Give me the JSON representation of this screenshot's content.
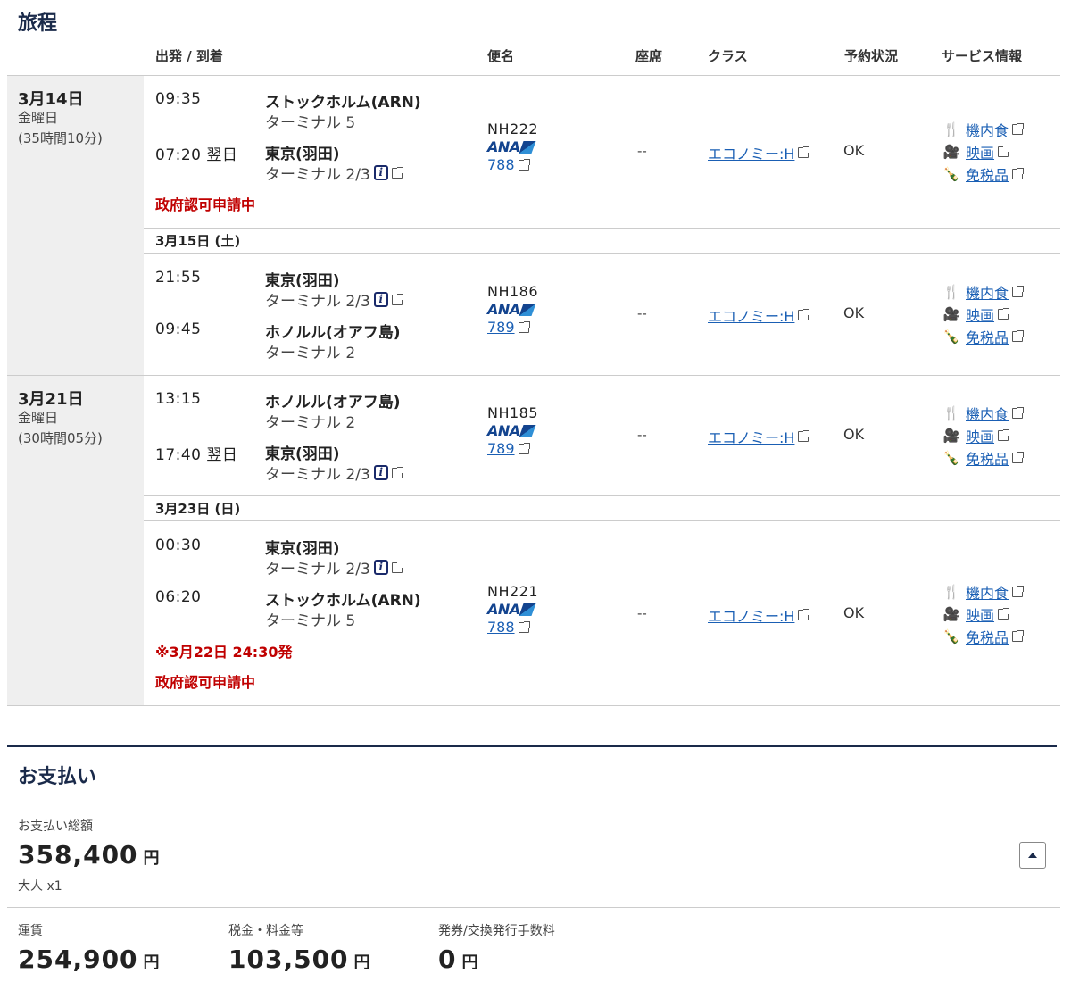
{
  "itinerary": {
    "title": "旅程",
    "headers": {
      "route": "出発 / 到着",
      "flight": "便名",
      "seat": "座席",
      "class": "クラス",
      "status": "予約状況",
      "service": "サービス情報"
    },
    "trips": [
      {
        "date": "3月14日",
        "weekday": "金曜日",
        "duration": "(35時間10分)"
      },
      {
        "date": "3月21日",
        "weekday": "金曜日",
        "duration": "(30時間05分)"
      }
    ],
    "date_rows": [
      "3月15日 (土)",
      "3月23日 (日)"
    ],
    "segments": [
      {
        "dep_time": "09:35",
        "dep_place": "ストックホルム(ARN)",
        "dep_terminal": "ターミナル 5",
        "arr_time": "07:20 翌日",
        "arr_place": "東京(羽田)",
        "arr_terminal": "ターミナル 2/3",
        "flight_no": "NH222",
        "airline": "ANA",
        "aircraft": "788",
        "seat": "--",
        "class": "エコノミー:H",
        "status": "OK",
        "notes": [
          "政府認可申請中"
        ]
      },
      {
        "dep_time": "21:55",
        "dep_place": "東京(羽田)",
        "dep_terminal": "ターミナル 2/3",
        "arr_time": "09:45",
        "arr_place": "ホノルル(オアフ島)",
        "arr_terminal": "ターミナル 2",
        "flight_no": "NH186",
        "airline": "ANA",
        "aircraft": "789",
        "seat": "--",
        "class": "エコノミー:H",
        "status": "OK",
        "notes": []
      },
      {
        "dep_time": "13:15",
        "dep_place": "ホノルル(オアフ島)",
        "dep_terminal": "ターミナル 2",
        "arr_time": "17:40 翌日",
        "arr_place": "東京(羽田)",
        "arr_terminal": "ターミナル 2/3",
        "flight_no": "NH185",
        "airline": "ANA",
        "aircraft": "789",
        "seat": "--",
        "class": "エコノミー:H",
        "status": "OK",
        "notes": []
      },
      {
        "dep_time": "00:30",
        "dep_place": "東京(羽田)",
        "dep_terminal": "ターミナル 2/3",
        "arr_time": "06:20",
        "arr_place": "ストックホルム(ARN)",
        "arr_terminal": "ターミナル 5",
        "flight_no": "NH221",
        "airline": "ANA",
        "aircraft": "788",
        "seat": "--",
        "class": "エコノミー:H",
        "status": "OK",
        "notes": [
          "※3月22日 24:30発",
          "政府認可申請中"
        ]
      }
    ],
    "services": {
      "meal": "機内食",
      "movie": "映画",
      "dutyfree": "免税品"
    },
    "service_icons": {
      "meal": "cutlery-icon",
      "movie": "film-camera-icon",
      "dutyfree": "bottle-icon"
    }
  },
  "payment": {
    "title": "お支払い",
    "total_label": "お支払い総額",
    "total_value": "358,400",
    "currency": "円",
    "passengers": "大人 x1",
    "fare_label": "運賃",
    "fare_value": "254,900",
    "tax_label": "税金・料金等",
    "tax_value": "103,500",
    "fee_label": "発券/交換発行手数料",
    "fee_value": "0"
  },
  "colors": {
    "navy": "#1a2a4a",
    "link": "#1a5fb4",
    "alert": "#c00000",
    "ana_blue": "#13448f"
  }
}
